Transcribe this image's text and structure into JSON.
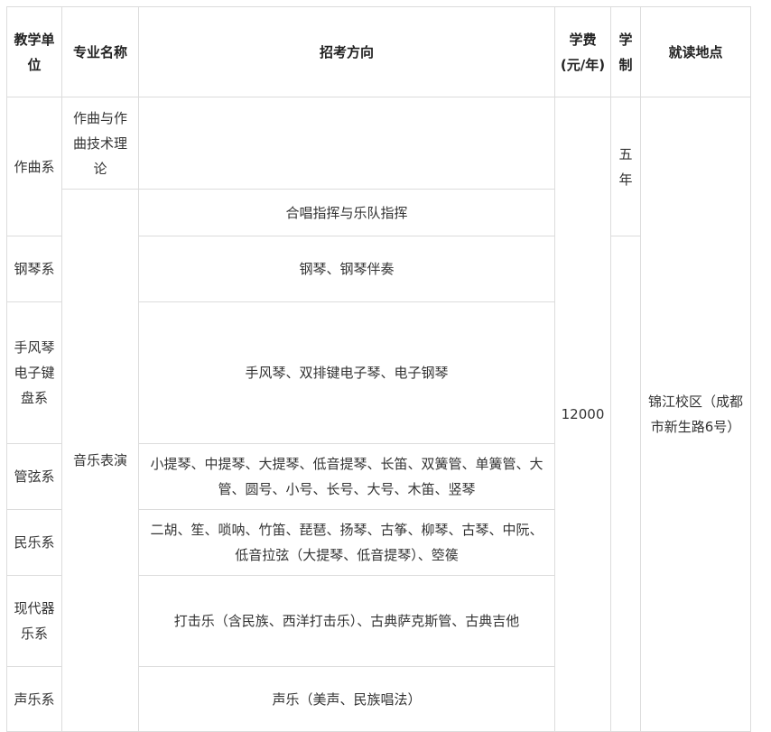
{
  "headers": {
    "unit": "教学单位",
    "major": "专业名称",
    "direction": "招考方向",
    "fee": "学费(元/年)",
    "duration": "学制",
    "location": "就读地点"
  },
  "majors": {
    "composition": "作曲与作曲技术理论",
    "performance": "音乐表演"
  },
  "rows": [
    {
      "unit": "作曲系",
      "direction": ""
    },
    {
      "unit": "",
      "direction": "合唱指挥与乐队指挥"
    },
    {
      "unit": "钢琴系",
      "direction": "钢琴、钢琴伴奏"
    },
    {
      "unit": "手风琴电子键盘系",
      "direction": "手风琴、双排键电子琴、电子钢琴"
    },
    {
      "unit": "管弦系",
      "direction": "小提琴、中提琴、大提琴、低音提琴、长笛、双簧管、单簧管、大管、圆号、小号、长号、大号、木笛、竖琴"
    },
    {
      "unit": "民乐系",
      "direction": "二胡、笙、唢呐、竹笛、琵琶、扬琴、古筝、柳琴、古琴、中阮、低音拉弦（大提琴、低音提琴）、箜篌"
    },
    {
      "unit": "现代器乐系",
      "direction": "打击乐（含民族、西洋打击乐）、古典萨克斯管、古典吉他"
    },
    {
      "unit": "声乐系",
      "direction": "声乐（美声、民族唱法）"
    }
  ],
  "fee": "12000",
  "duration": "五年",
  "location": "锦江校区（成都市新生路6号）"
}
